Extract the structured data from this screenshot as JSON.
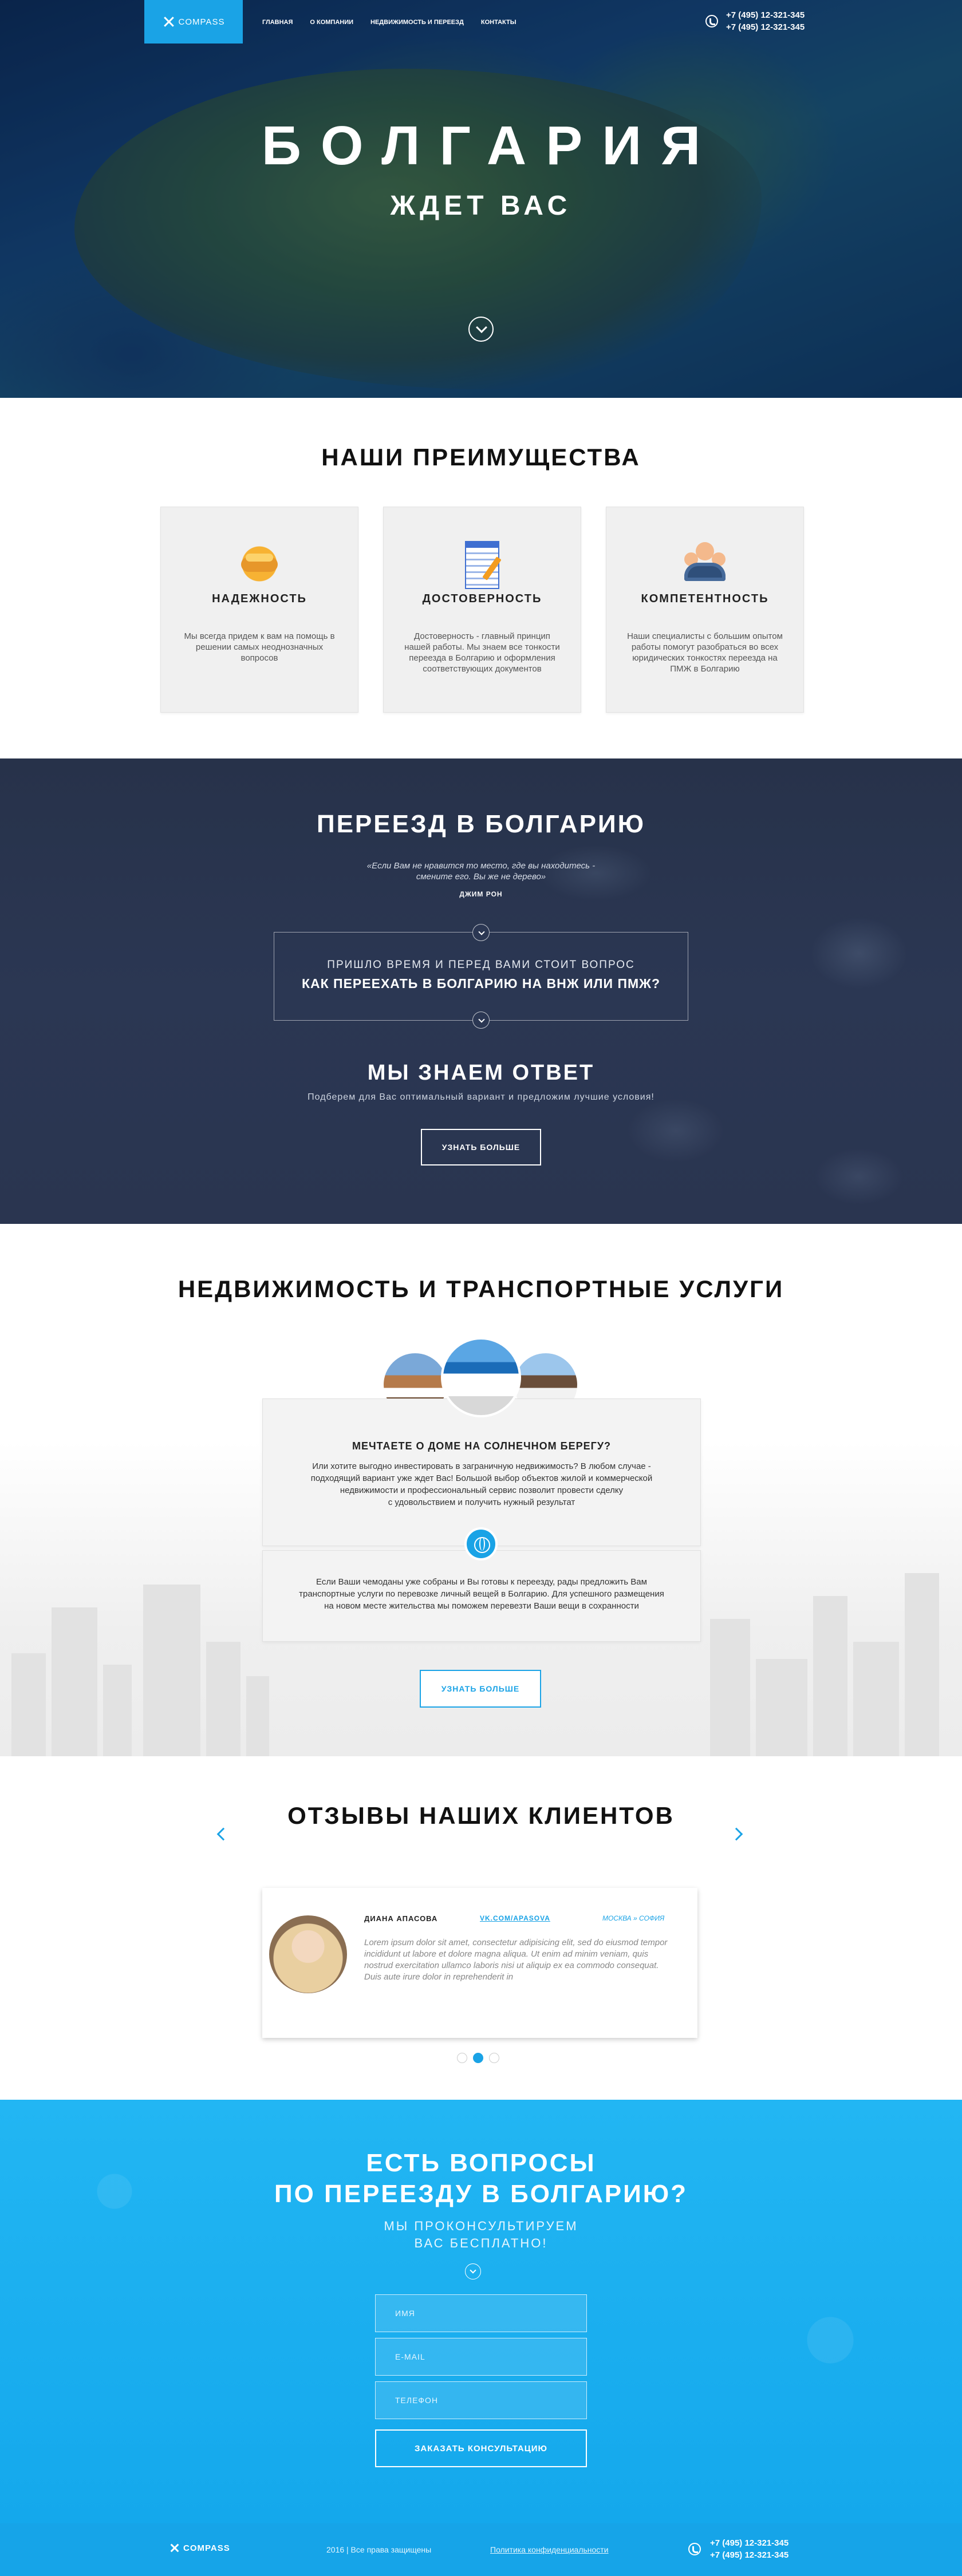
{
  "brand": {
    "logo_text": "COMPASS"
  },
  "nav": {
    "items": [
      "Главная",
      "О компании",
      "Недвижимость и переезд",
      "Контакты"
    ],
    "phones": [
      "+7 (495) 12-321-345",
      "+7 (495) 12-321-345"
    ]
  },
  "hero": {
    "title": "БОЛГАРИЯ",
    "subtitle": "ЖДЕТ ВАС"
  },
  "advantages": {
    "title": "НАШИ ПРЕИМУЩЕСТВА",
    "cards": [
      {
        "icon": "handshake-icon",
        "title": "НАДЕЖНОСТЬ",
        "text": "Мы всегда придем к вам на помощь в решении самых неоднозначных вопросов"
      },
      {
        "icon": "document-icon",
        "title": "ДОСТОВЕРНОСТЬ",
        "text": "Достоверность - главный принцип нашей работы. Мы знаем все тонкости переезда в Болгарию и оформления соответствующих документов"
      },
      {
        "icon": "team-icon",
        "title": "КОМПЕТЕНТНОСТЬ",
        "text": "Наши специалисты с большим опытом работы помогут разобраться во всех юридических тонкостях переезда на ПМЖ в Болгарию"
      }
    ]
  },
  "relocate": {
    "title": "ПЕРЕЕЗД В БОЛГАРИЮ",
    "quote_line1": "«Если Вам не нравится то место, где вы находитесь -",
    "quote_line2": "смените его. Вы же не дерево»",
    "quote_author": "ДЖИМ РОН",
    "question_line1": "ПРИШЛО ВРЕМЯ И ПЕРЕД ВАМИ СТОИТ ВОПРОС",
    "question_line2": "КАК ПЕРЕЕХАТЬ В БОЛГАРИЮ НА ВНЖ ИЛИ ПМЖ?",
    "answer_title": "МЫ ЗНАЕМ ОТВЕТ",
    "answer_text": "Подберем для Вас оптимальный вариант и предложим лучшие условия!",
    "button": "УЗНАТЬ БОЛЬШЕ"
  },
  "services": {
    "title": "НЕДВИЖИМОСТЬ И ТРАНСПОРТНЫЕ УСЛУГИ",
    "card1_title": "МЕЧТАЕТЕ О ДОМЕ НА СОЛНЕЧНОМ БЕРЕГУ?",
    "card1_lines": [
      "Или хотите выгодно инвестировать в заграничную недвижимость? В любом случае -",
      "подходящий вариант уже ждет Вас! Большой выбор объектов жилой и коммерческой",
      "недвижимости и профессиональный сервис позволит провести сделку",
      "с удовольствием и получить нужный результат"
    ],
    "card2_lines": [
      "Если Ваши чемоданы уже собраны и Вы готовы к переезду, рады предложить Вам",
      "транспортные услуги по перевозке личный вещей в Болгарию. Для успешного размещения",
      "на новом месте жительства мы поможем перевезти Ваши вещи в сохранности"
    ],
    "button": "УЗНАТЬ БОЛЬШЕ"
  },
  "reviews": {
    "title": "ОТЗЫВЫ НАШИХ КЛИЕНТОВ",
    "name": "ДИАНА АПАСОВА",
    "link": "VK.COM/APASOVA",
    "route": "МОСКВА » СОФИЯ",
    "text": "Lorem ipsum dolor sit amet, consectetur adipisicing elit, sed do eiusmod tempor incididunt ut labore et dolore magna aliqua. Ut enim ad minim veniam, quis nostrud exercitation ullamco laboris nisi ut aliquip ex ea commodo consequat. Duis aute irure dolor in reprehenderit in",
    "active_dot": 2
  },
  "contact": {
    "title_line1": "ЕСТЬ ВОПРОСЫ",
    "title_line2": "ПО ПЕРЕЕЗДУ В БОЛГАРИЮ?",
    "sub_line1": "МЫ ПРОКОНСУЛЬТИРУЕМ",
    "sub_line2": "ВАС БЕСПЛАТНО!",
    "fields": {
      "name": "ИМЯ",
      "email": "E-MAIL",
      "phone": "ТЕЛЕФОН"
    },
    "submit": "ЗАКАЗАТЬ КОНСУЛЬТАЦИЮ"
  },
  "footer": {
    "logo_text": "COMPASS",
    "copyright": "2016 | Все права защищены",
    "policy": "Политика конфиденциальности",
    "phones": [
      "+7 (495) 12-321-345",
      "+7 (495) 12-321-345"
    ]
  },
  "colors": {
    "accent": "#1aa3e6",
    "dark_section": "#2b3753",
    "contact_bg": "#1ab2f2"
  }
}
